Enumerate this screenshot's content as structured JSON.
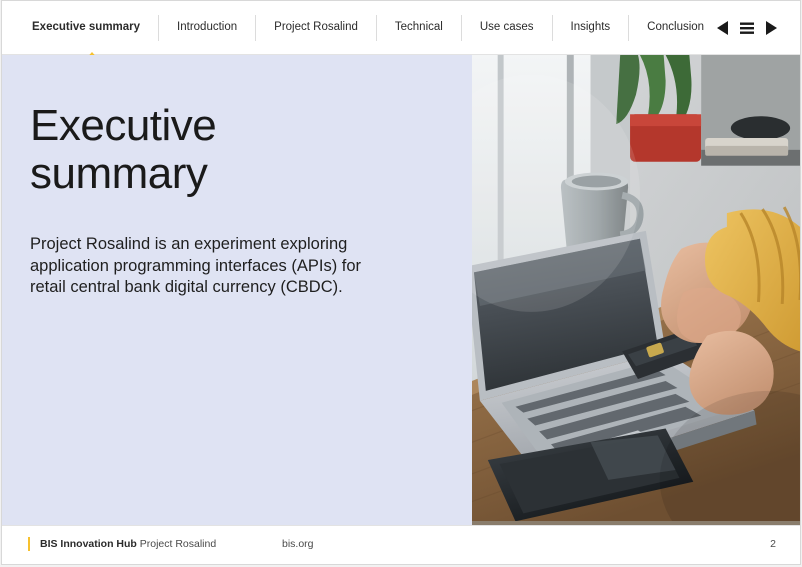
{
  "nav": {
    "items": [
      {
        "label": "Executive summary",
        "active": true
      },
      {
        "label": "Introduction",
        "active": false
      },
      {
        "label": "Project Rosalind",
        "active": false
      },
      {
        "label": "Technical",
        "active": false
      },
      {
        "label": "Use cases",
        "active": false
      },
      {
        "label": "Insights",
        "active": false
      },
      {
        "label": "Conclusion",
        "active": false
      }
    ],
    "controls": {
      "prev": "prev-triangle-icon",
      "menu": "hamburger-menu-icon",
      "next": "next-triangle-icon"
    },
    "accent_color": "#f7c12e"
  },
  "slide": {
    "title_line1": "Executive",
    "title_line2": "summary",
    "body_line1": "Project Rosalind is an experiment exploring",
    "body_line2": "application programming interfaces (APIs) for",
    "body_line3": "retail central bank digital currency (CBDC).",
    "panel_color": "#dfe3f3"
  },
  "image": {
    "alt": "person using a laptop with a payment card and smartphone on a wooden desk"
  },
  "footer": {
    "org_bold": "BIS Innovation Hub",
    "org_light": " Project Rosalind",
    "url": "bis.org",
    "page_number": "2"
  }
}
